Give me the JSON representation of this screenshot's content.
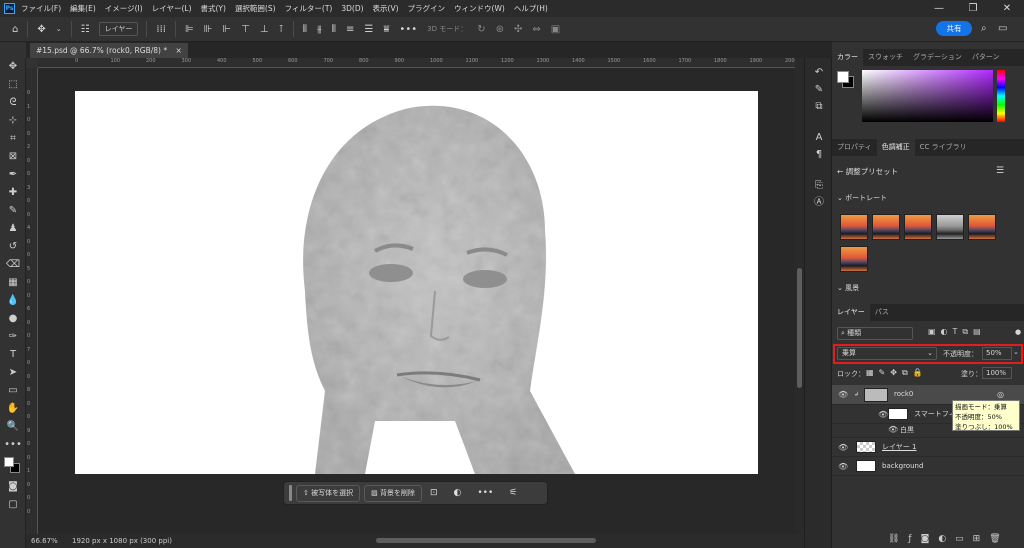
{
  "menu": {
    "app_icon": "Ps",
    "items": [
      "ファイル(F)",
      "編集(E)",
      "イメージ(I)",
      "レイヤー(L)",
      "書式(Y)",
      "選択範囲(S)",
      "フィルター(T)",
      "3D(D)",
      "表示(V)",
      "プラグイン",
      "ウィンドウ(W)",
      "ヘルプ(H)"
    ],
    "window_controls": [
      "—",
      "❐",
      "✕"
    ]
  },
  "options_bar": {
    "layer_select": "レイヤー",
    "three_d_mode": "3D モード：",
    "more": "•••",
    "share_label": "共有"
  },
  "document_tab": {
    "title": "#15.psd @ 66.7% (rock0, RGB/8) *",
    "close": "×"
  },
  "rulers": {
    "top_ticks": [
      "0",
      "100",
      "200",
      "300",
      "400",
      "500",
      "600",
      "700",
      "800",
      "900",
      "1000",
      "1100",
      "1200",
      "1300",
      "1400",
      "1500",
      "1600",
      "1700",
      "1800",
      "1900",
      "2000"
    ],
    "left_ticks": [
      "0",
      "1",
      "0",
      "0",
      "2",
      "0",
      "0",
      "3",
      "0",
      "0",
      "4",
      "0",
      "0",
      "5",
      "0",
      "0",
      "6",
      "0",
      "0",
      "7",
      "0",
      "0",
      "8",
      "0",
      "0",
      "9",
      "0",
      "0",
      "1",
      "0",
      "0",
      "0"
    ]
  },
  "status": {
    "zoom": "66.67%",
    "doc_info": "1920 px x 1080 px (300 ppi)"
  },
  "context_bar": {
    "select_subject": "被写体を選択",
    "remove_background": "背景を削除",
    "more": "•••"
  },
  "color_panel": {
    "tabs": [
      "カラー",
      "スウォッチ",
      "グラデーション",
      "パターン"
    ],
    "foreground": "#ffffff",
    "background": "#000000"
  },
  "adjust_panel": {
    "tabs": [
      "プロパティ",
      "色調補正",
      "CC ライブラリ"
    ],
    "title": "調整プリセット",
    "section_portrait": "ポートレート",
    "section_landscape": "風景"
  },
  "layers_panel": {
    "tabs": [
      "レイヤー",
      "パス"
    ],
    "filter_kind": "種類",
    "blend_mode": "乗算",
    "opacity_label": "不透明度：",
    "opacity_value": "50%",
    "lock_label": "ロック：",
    "fill_label": "塗り：",
    "fill_value": "100%",
    "layers": [
      {
        "name": "rock0"
      },
      {
        "name": "スマートフィルター"
      },
      {
        "name": "白黒"
      },
      {
        "name": "レイヤー 1"
      },
      {
        "name": "background"
      }
    ],
    "tooltip": [
      "描画モード：乗算",
      "不透明度：50%",
      "塗りつぶし：100%"
    ],
    "highlight_color": "#e01e1e"
  }
}
